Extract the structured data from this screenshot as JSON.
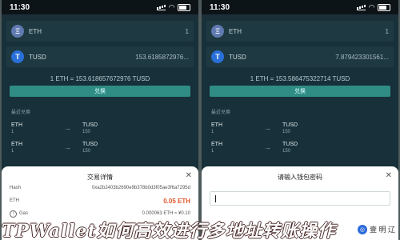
{
  "left_screen": {
    "time": "11:30",
    "tokens": [
      {
        "symbol": "ETH",
        "icon": "eth-icon",
        "amount": "1"
      },
      {
        "symbol": "TUSD",
        "icon": "tusd-icon",
        "amount": "153.6185872976..."
      }
    ],
    "rate": "1 ETH = 153.618657672976 TUSD",
    "exchange_label": "兑换",
    "section_title": "最近兑换",
    "recent_trades": [
      {
        "from_symbol": "ETH",
        "from_value": "1",
        "to_symbol": "TUSD",
        "to_value": "150"
      },
      {
        "from_symbol": "ETH",
        "from_value": "1",
        "to_symbol": "TUSD",
        "to_value": "150"
      }
    ],
    "sheet": {
      "title": "交易详情",
      "close_icon": "✕",
      "rows": [
        {
          "label": "Hash",
          "value": "0xa2b2403b2690e9b378b0d3f05ae3f6a7295d"
        },
        {
          "label": "ETH",
          "value": "0.05 ETH"
        },
        {
          "label": "Gas",
          "value": "0.000063 ETH ≈ ¥0.10"
        }
      ]
    }
  },
  "right_screen": {
    "time": "11:30",
    "tokens": [
      {
        "symbol": "ETH",
        "icon": "eth-icon",
        "amount": "1"
      },
      {
        "symbol": "TUSD",
        "icon": "tusd-icon",
        "amount": "7.879423301561..."
      }
    ],
    "rate": "1 ETH = 153.586475322714 TUSD",
    "exchange_label": "兑换",
    "section_title": "最近兑换",
    "recent_trades": [
      {
        "from_symbol": "ETH",
        "from_value": "1",
        "to_symbol": "TUSD",
        "to_value": "150"
      },
      {
        "from_symbol": "ETH",
        "from_value": "1",
        "to_symbol": "TUSD",
        "to_value": "150"
      }
    ],
    "sheet": {
      "title": "请输入钱包密码",
      "close_icon": "✕",
      "input_placeholder": ""
    }
  },
  "overlay": {
    "ad_text": "壹 明 辽"
  },
  "headline": "TPWallet如何高效进行多地址转账操作"
}
